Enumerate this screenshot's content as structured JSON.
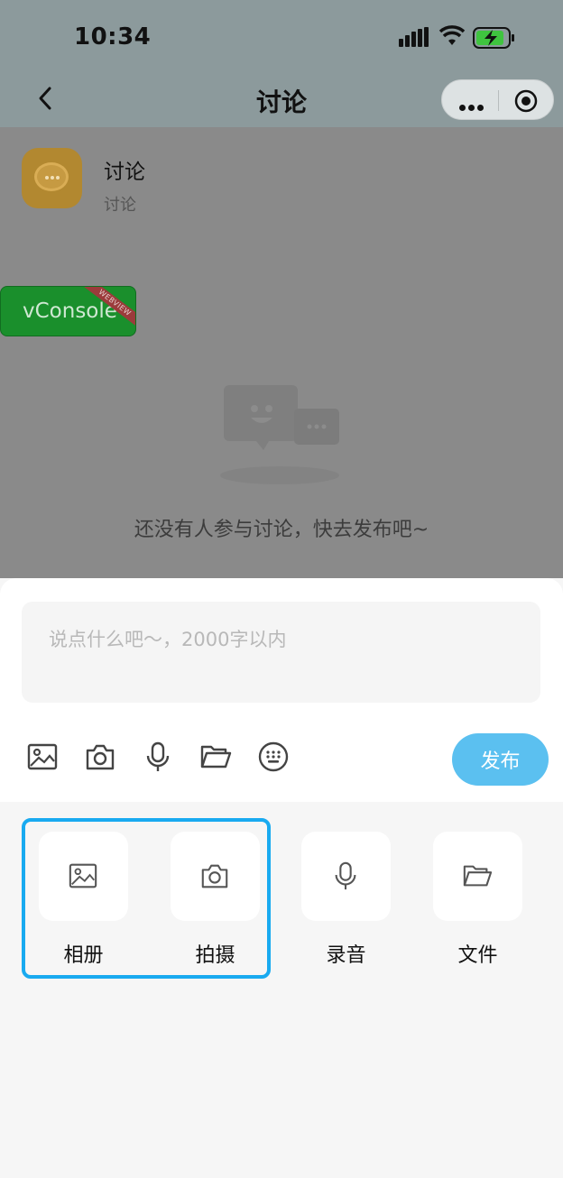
{
  "status_bar": {
    "time": "10:34"
  },
  "nav": {
    "title": "讨论"
  },
  "app": {
    "name": "讨论",
    "subtitle": "讨论"
  },
  "vconsole": {
    "label": "vConsole",
    "ribbon": "WEBVIEW"
  },
  "empty_state": {
    "text": "还没有人参与讨论，快去发布吧~"
  },
  "composer": {
    "placeholder": "说点什么吧～，2000字以内",
    "value": ""
  },
  "toolbar": {
    "icons": [
      "image-icon",
      "camera-icon",
      "microphone-icon",
      "folder-icon",
      "keyboard-icon"
    ],
    "publish_label": "发布"
  },
  "tray": {
    "items": [
      {
        "label": "相册",
        "icon": "image-icon"
      },
      {
        "label": "拍摄",
        "icon": "camera-icon"
      },
      {
        "label": "录音",
        "icon": "microphone-icon"
      },
      {
        "label": "文件",
        "icon": "folder-icon"
      }
    ]
  },
  "colors": {
    "accent": "#5bc0f0",
    "highlight": "#19aaf0",
    "vconsole_green": "#1a8f2c"
  }
}
